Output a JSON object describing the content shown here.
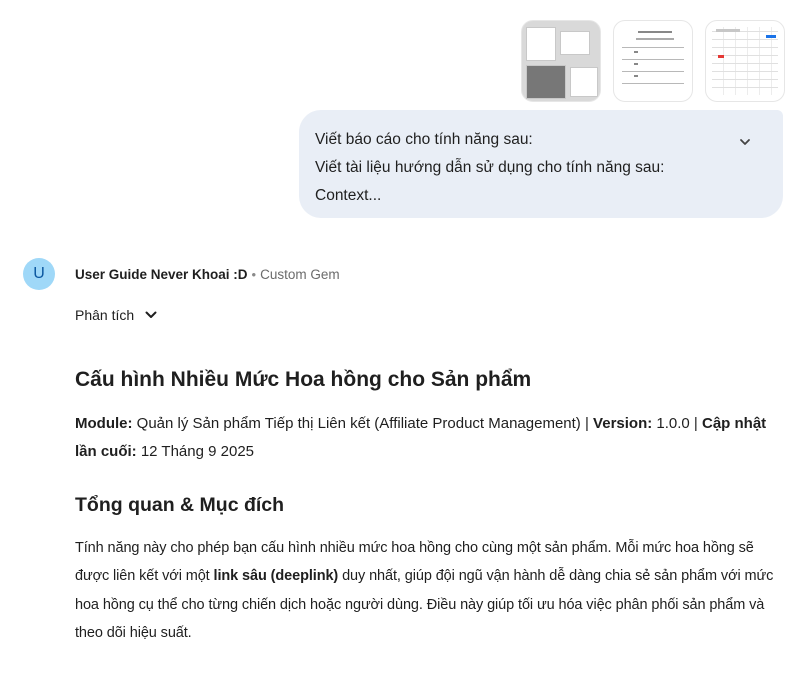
{
  "attachments": [
    {
      "name": "screenshot-1"
    },
    {
      "name": "screenshot-2"
    },
    {
      "name": "screenshot-3"
    }
  ],
  "prompt": {
    "lines": [
      "Viết báo cáo cho tính năng sau:",
      "Viết tài liệu hướng dẫn sử dụng cho tính năng sau:",
      "Context..."
    ],
    "expand_icon": "chevron-down-icon"
  },
  "gem": {
    "avatar_letter": "U",
    "name": "User Guide Never Khoai :D",
    "separator": "•",
    "tag": "Custom Gem"
  },
  "analysis": {
    "label": "Phân tích",
    "icon": "chevron-down-icon"
  },
  "doc": {
    "title": "Cấu hình Nhiều Mức Hoa hồng cho Sản phẩm",
    "meta": {
      "module_label": "Module:",
      "module_value": " Quản lý Sản phẩm Tiếp thị Liên kết (Affiliate Product Management) | ",
      "version_label": "Version:",
      "version_value": " 1.0.0 | ",
      "updated_label": "Cập nhật lần cuối:",
      "updated_value": " 12 Tháng 9 2025"
    },
    "section_title": "Tổng quan & Mục đích",
    "paragraph": {
      "part1": "Tính năng này cho phép bạn cấu hình nhiều mức hoa hồng cho cùng một sản phẩm. Mỗi mức hoa hồng sẽ được liên kết với một ",
      "bold": "link sâu (deeplink)",
      "part2": " duy nhất, giúp đội ngũ vận hành dễ dàng chia sẻ sản phẩm với mức hoa hồng cụ thể cho từng chiến dịch hoặc người dùng. Điều này giúp tối ưu hóa việc phân phối sản phẩm và theo dõi hiệu suất."
    }
  }
}
